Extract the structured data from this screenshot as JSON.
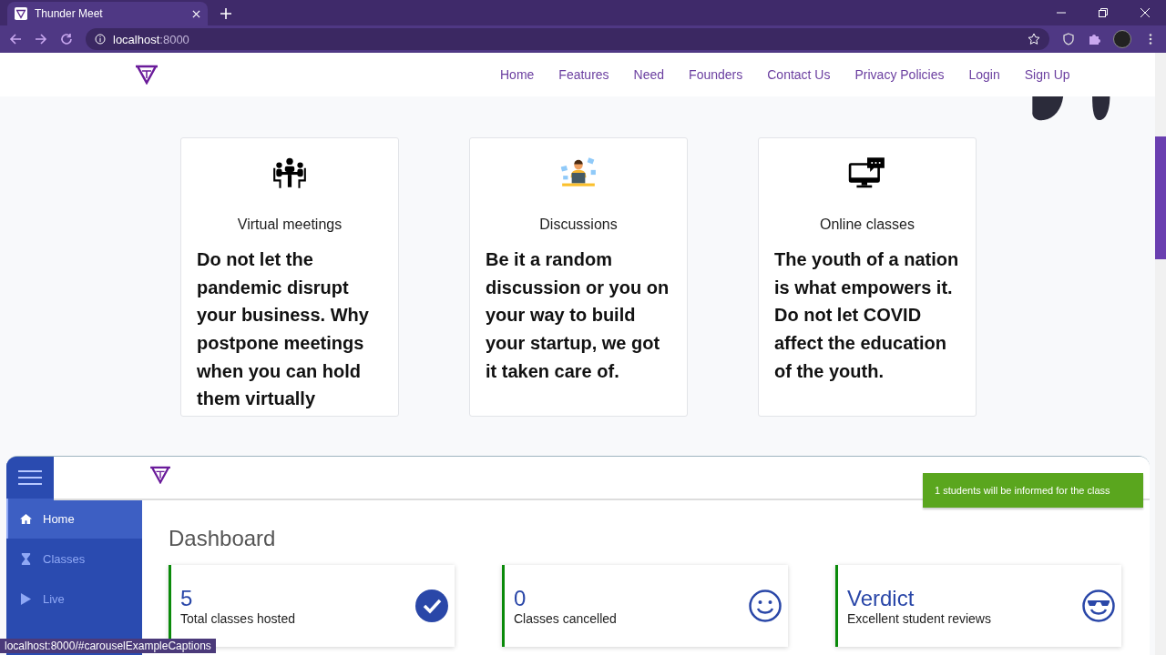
{
  "browser": {
    "tab_title": "Thunder Meet",
    "url_host": "localhost",
    "url_port": ":8000",
    "status_url": "localhost:8000/#carouselExampleCaptions"
  },
  "nav": {
    "links": [
      {
        "label": "Home"
      },
      {
        "label": "Features"
      },
      {
        "label": "Need"
      },
      {
        "label": "Founders"
      },
      {
        "label": "Contact Us"
      },
      {
        "label": "Privacy Policies"
      },
      {
        "label": "Login"
      },
      {
        "label": "Sign Up"
      }
    ]
  },
  "features": [
    {
      "title": "Virtual meetings",
      "text": "Do not let the pandemic disrupt your business. Why postpone meetings when you can hold them virtually"
    },
    {
      "title": "Discussions",
      "text": "Be it a random discussion or you on your way to build your startup, we got it taken care of."
    },
    {
      "title": "Online classes",
      "text": "The youth of a nation is what empowers it. Do not let COVID affect the education of the youth."
    }
  ],
  "dashboard": {
    "sidebar": [
      {
        "label": "Home",
        "selected": true
      },
      {
        "label": "Classes",
        "selected": false
      },
      {
        "label": "Live",
        "selected": false
      }
    ],
    "heading": "Dashboard",
    "stats": [
      {
        "value": "5",
        "label": "Total classes hosted"
      },
      {
        "value": "0",
        "label": "Classes cancelled"
      },
      {
        "value": "Verdict",
        "label": "Excellent student reviews"
      }
    ],
    "toast": "1 students will be informed for the class"
  }
}
